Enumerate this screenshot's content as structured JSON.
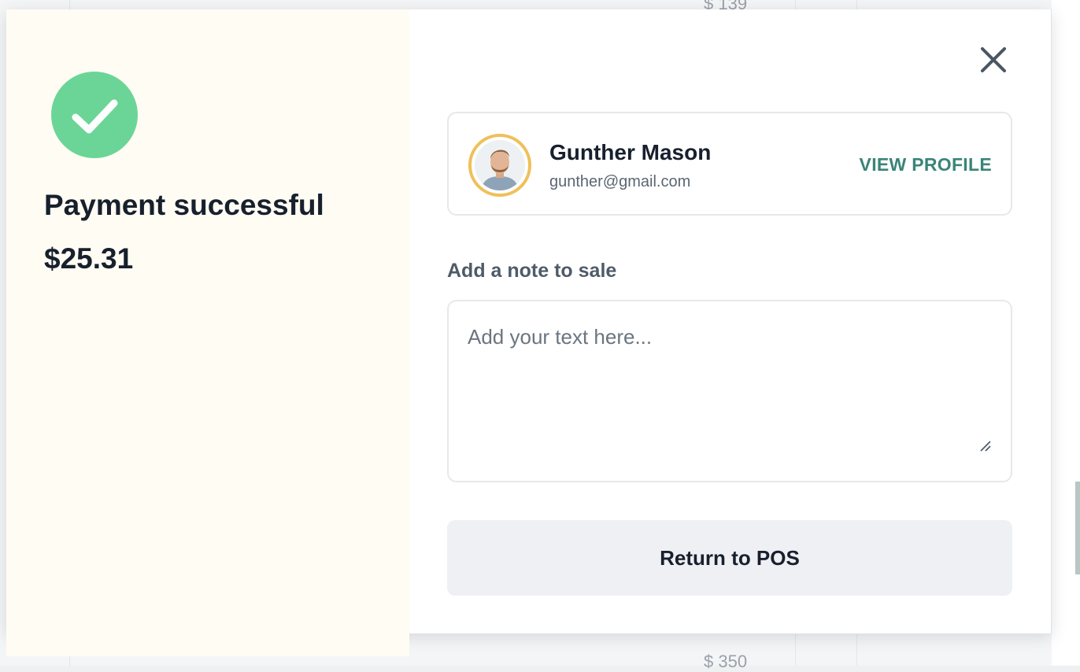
{
  "background": {
    "price_top": "$ 139",
    "price_bottom": "$ 350"
  },
  "payment": {
    "status_icon": "check-icon",
    "title": "Payment successful",
    "amount": "$25.31",
    "success_color": "#6bd597"
  },
  "close": {
    "icon": "close-icon"
  },
  "customer": {
    "name": "Gunther Mason",
    "email": "gunther@gmail.com",
    "view_profile_label": "VIEW PROFILE",
    "avatar_ring_color": "#efc05a",
    "link_color": "#3a8577"
  },
  "note": {
    "label": "Add a note to sale",
    "placeholder": "Add your text here...",
    "value": ""
  },
  "actions": {
    "return_label": "Return to POS"
  }
}
